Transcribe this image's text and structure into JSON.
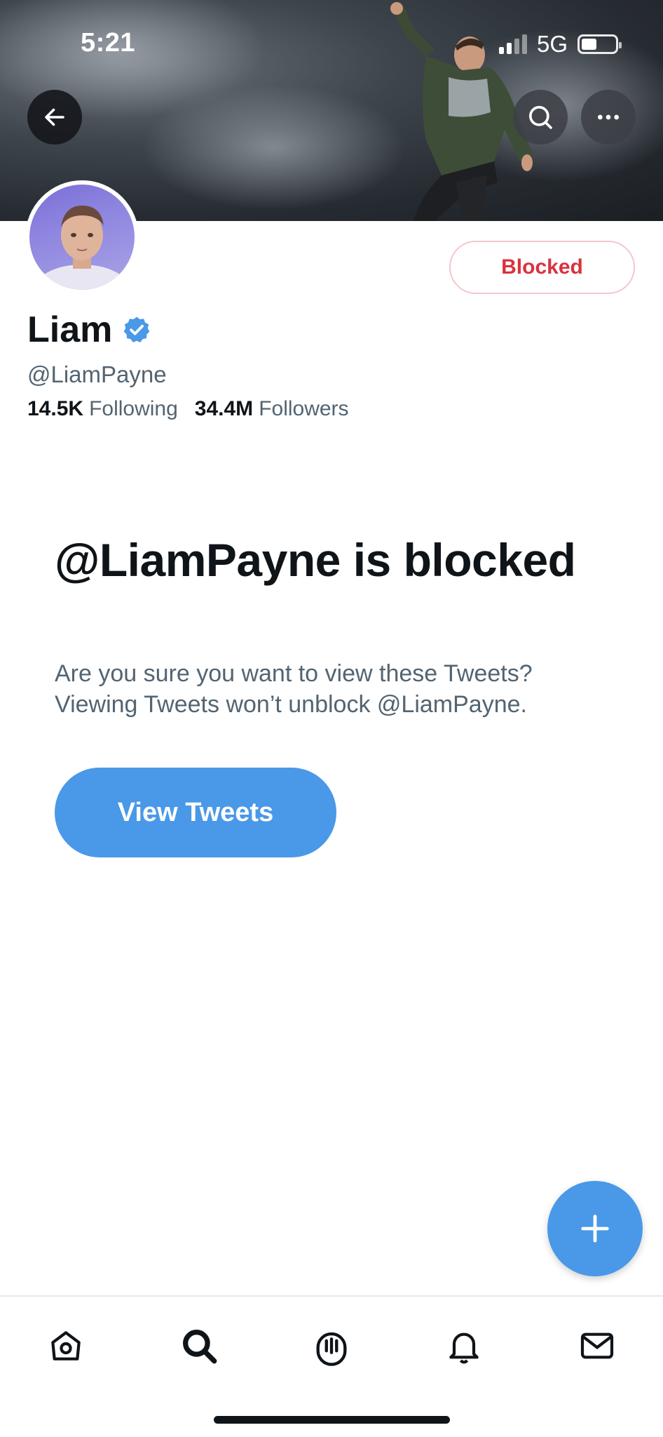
{
  "status_bar": {
    "time": "5:21",
    "network": "5G"
  },
  "profile": {
    "display_name": "Liam",
    "handle": "@LiamPayne",
    "following_count": "14.5K",
    "following_label": "Following",
    "followers_count": "34.4M",
    "followers_label": "Followers",
    "blocked_button_label": "Blocked",
    "verified_icon": "verified-badge-icon"
  },
  "blocked_notice": {
    "title": "@LiamPayne is blocked",
    "description": "Are you sure you want to view these Tweets? Viewing Tweets won’t unblock @LiamPayne.",
    "view_button_label": "View Tweets"
  },
  "tabbar": {
    "items": [
      "home-icon",
      "search-icon",
      "spaces-icon",
      "notifications-icon",
      "messages-icon"
    ]
  },
  "colors": {
    "accent": "#4a98e8",
    "blocked_text": "#d9323f",
    "secondary_text": "#536471"
  }
}
